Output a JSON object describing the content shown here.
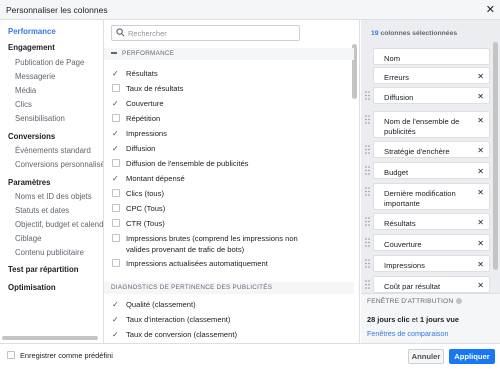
{
  "dialog": {
    "title": "Personnaliser les colonnes",
    "close_icon": "close-icon"
  },
  "sidebar": {
    "items": [
      {
        "label": "Performance",
        "kind": "active"
      },
      {
        "label": "Engagement",
        "kind": "head"
      },
      {
        "label": "Publication de Page",
        "kind": "sub"
      },
      {
        "label": "Messagerie",
        "kind": "sub"
      },
      {
        "label": "Média",
        "kind": "sub"
      },
      {
        "label": "Clics",
        "kind": "sub"
      },
      {
        "label": "Sensibilisation",
        "kind": "sub"
      },
      {
        "label": "Conversions",
        "kind": "head"
      },
      {
        "label": "Évènements standard",
        "kind": "sub"
      },
      {
        "label": "Conversions personnalisées",
        "kind": "sub"
      },
      {
        "label": "Paramètres",
        "kind": "head"
      },
      {
        "label": "Noms et ID des objets",
        "kind": "sub"
      },
      {
        "label": "Statuts et dates",
        "kind": "sub"
      },
      {
        "label": "Objectif, budget et calendrier",
        "kind": "sub"
      },
      {
        "label": "Ciblage",
        "kind": "sub"
      },
      {
        "label": "Contenu publicitaire",
        "kind": "sub"
      },
      {
        "label": "Test par répartition",
        "kind": "head"
      },
      {
        "label": "Optimisation",
        "kind": "head"
      }
    ]
  },
  "search": {
    "placeholder": "Rechercher"
  },
  "sections": {
    "performance": {
      "title": "PERFORMANCE",
      "options": [
        {
          "label": "Résultats",
          "checked": true
        },
        {
          "label": "Taux de résultats",
          "checked": false
        },
        {
          "label": "Couverture",
          "checked": true
        },
        {
          "label": "Répétition",
          "checked": false
        },
        {
          "label": "Impressions",
          "checked": true
        },
        {
          "label": "Diffusion",
          "checked": true
        },
        {
          "label": "Diffusion de l'ensemble de publicités",
          "checked": false
        },
        {
          "label": "Montant dépensé",
          "checked": true
        },
        {
          "label": "Clics (tous)",
          "checked": false
        },
        {
          "label": "CPC (Tous)",
          "checked": false
        },
        {
          "label": "CTR (Tous)",
          "checked": false
        },
        {
          "label": "Impressions brutes (comprend les impressions non",
          "label2": "valides provenant de trafic de bots)",
          "checked": false
        },
        {
          "label": "Impressions actualisées automatiquement",
          "checked": false
        }
      ]
    },
    "diagnostics": {
      "title": "DIAGNOSTICS DE PERTINENCE DES PUBLICITÉS",
      "options": [
        {
          "label": "Qualité (classement)",
          "checked": true
        },
        {
          "label": "Taux d'interaction (classement)",
          "checked": true
        },
        {
          "label": "Taux de conversion (classement)",
          "checked": true
        }
      ]
    }
  },
  "selected": {
    "count": "19",
    "suffix": "colonnes sélectionnées",
    "columns": [
      {
        "label": "Nom",
        "removable": false,
        "draggable": false
      },
      {
        "label": "Erreurs",
        "removable": true,
        "draggable": false
      },
      {
        "label": "Diffusion",
        "removable": true,
        "draggable": true
      },
      {
        "label": "Nom de l'ensemble de",
        "label2": "publicités",
        "removable": true,
        "draggable": true
      },
      {
        "label": "Stratégie d'enchère",
        "removable": true,
        "draggable": true
      },
      {
        "label": "Budget",
        "removable": true,
        "draggable": true
      },
      {
        "label": "Dernière modification",
        "label2": "importante",
        "removable": true,
        "draggable": true
      },
      {
        "label": "Résultats",
        "removable": true,
        "draggable": true
      },
      {
        "label": "Couverture",
        "removable": true,
        "draggable": true
      },
      {
        "label": "Impressions",
        "removable": true,
        "draggable": true
      },
      {
        "label": "Coût par résultat",
        "removable": true,
        "draggable": true
      }
    ]
  },
  "attribution": {
    "heading": "FENÊTRE D'ATTRIBUTION",
    "value_a": "28 jours clic",
    "value_mid": " et ",
    "value_b": "1 jours vue",
    "link": "Fenêtres de comparaison"
  },
  "footer": {
    "save_preset": "Enregistrer comme prédéfini",
    "cancel": "Annuler",
    "apply": "Appliquer"
  },
  "colors": {
    "accent": "#3578e5",
    "apply": "#1877f2",
    "panel": "#ebedf0"
  }
}
